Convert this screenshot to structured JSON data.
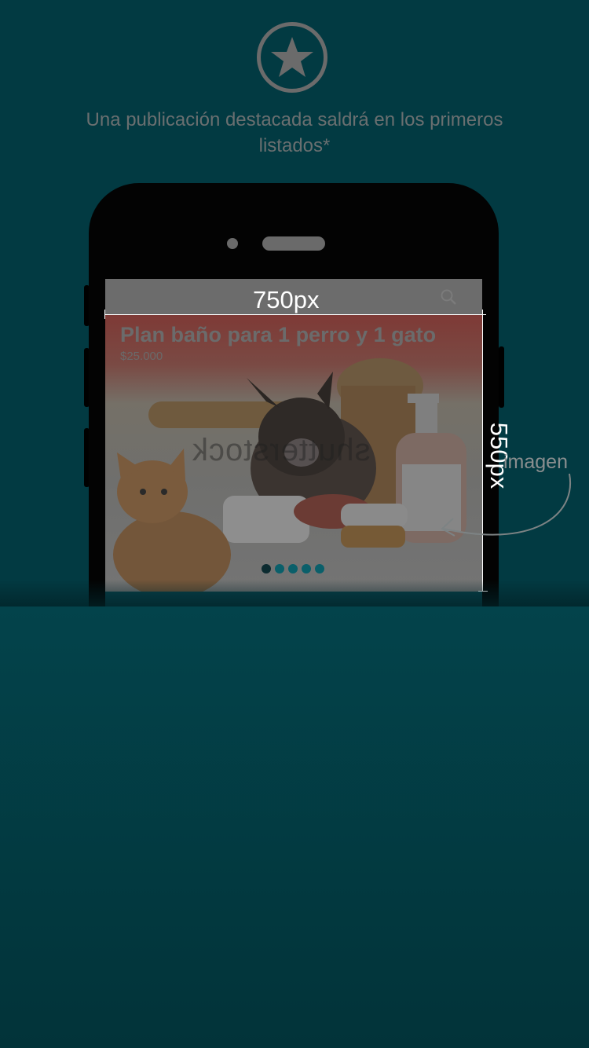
{
  "header": {
    "icon": "star-icon",
    "caption": "Una publicación destacada saldrá en los primeros listados*"
  },
  "phone_screen": {
    "search_icon": "search-icon",
    "listing": {
      "title": "Plan baño para 1 perro y 1 gato",
      "price": "$25.000",
      "watermark": "shutterstock"
    },
    "carousel": {
      "dot_count": 5,
      "active_index": 0
    }
  },
  "annotations": {
    "width_label": "750px",
    "height_label": "550px",
    "image_label": "imagen"
  },
  "colors": {
    "background": "#023a42",
    "active_dot": "#0c2b30",
    "inactive_dot": "#0a5f6a"
  }
}
